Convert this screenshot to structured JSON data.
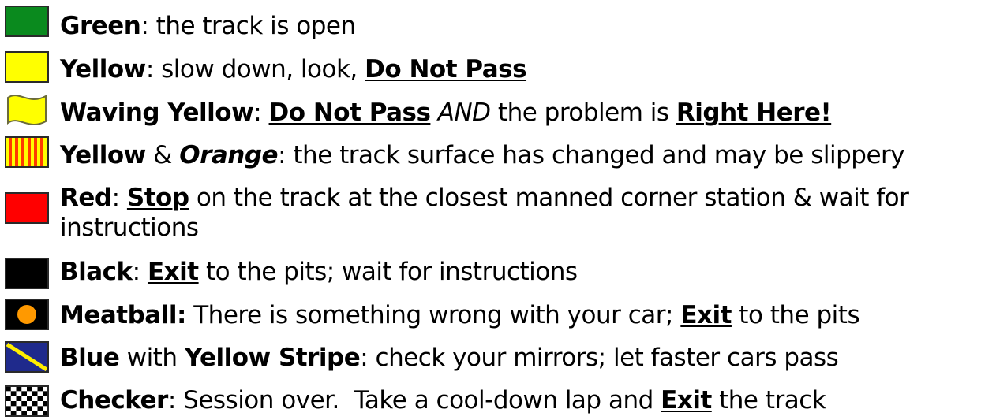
{
  "colors": {
    "green": "#0a8a1e",
    "yellow": "#ffff00",
    "orange": "#ff7a00",
    "red": "#ff0000",
    "black": "#000000",
    "meatball": "#ff9900",
    "blue": "#1f2a8c",
    "stripe": "#ffee00"
  },
  "flags": [
    {
      "icon": "green-flag-icon",
      "name": "Green",
      "sep": ": ",
      "desc": "the track is open"
    },
    {
      "icon": "yellow-flag-icon",
      "name": "Yellow",
      "sep": ": ",
      "desc": "slow down, look, ",
      "emph": "Do Not Pass"
    },
    {
      "icon": "waving-yellow-flag-icon",
      "name": "Waving Yellow",
      "sep": ": ",
      "emph": "Do Not Pass",
      "mid_italic": "AND",
      "desc": " the problem is ",
      "emph2": "Right Here!"
    },
    {
      "icon": "yellow-orange-striped-flag-icon",
      "name": "Yellow",
      "amp": " & ",
      "name2": "Orange",
      "sep": ": ",
      "desc": "the track surface has changed and may be slippery"
    },
    {
      "icon": "red-flag-icon",
      "name": "Red",
      "sep": ": ",
      "emph": "Stop",
      "desc": " on the track at the closest manned corner station & wait for instructions"
    },
    {
      "icon": "black-flag-icon",
      "name": "Black",
      "sep": ": ",
      "emph": "Exit",
      "desc": " to the pits; wait for instructions"
    },
    {
      "icon": "meatball-flag-icon",
      "name": "Meatball:",
      "desc": " There is something wrong with your car; ",
      "emph": "Exit",
      "desc2": " to the pits"
    },
    {
      "icon": "blue-yellow-stripe-flag-icon",
      "name": "Blue",
      "with": " with ",
      "name2": "Yellow Stripe",
      "sep": ": ",
      "desc": "check your mirrors; let faster cars pass"
    },
    {
      "icon": "checkered-flag-icon",
      "name": "Checker",
      "sep": ": ",
      "desc": "Session over.  Take a cool-down lap and ",
      "emph": "Exit",
      "desc2": " the track"
    }
  ]
}
